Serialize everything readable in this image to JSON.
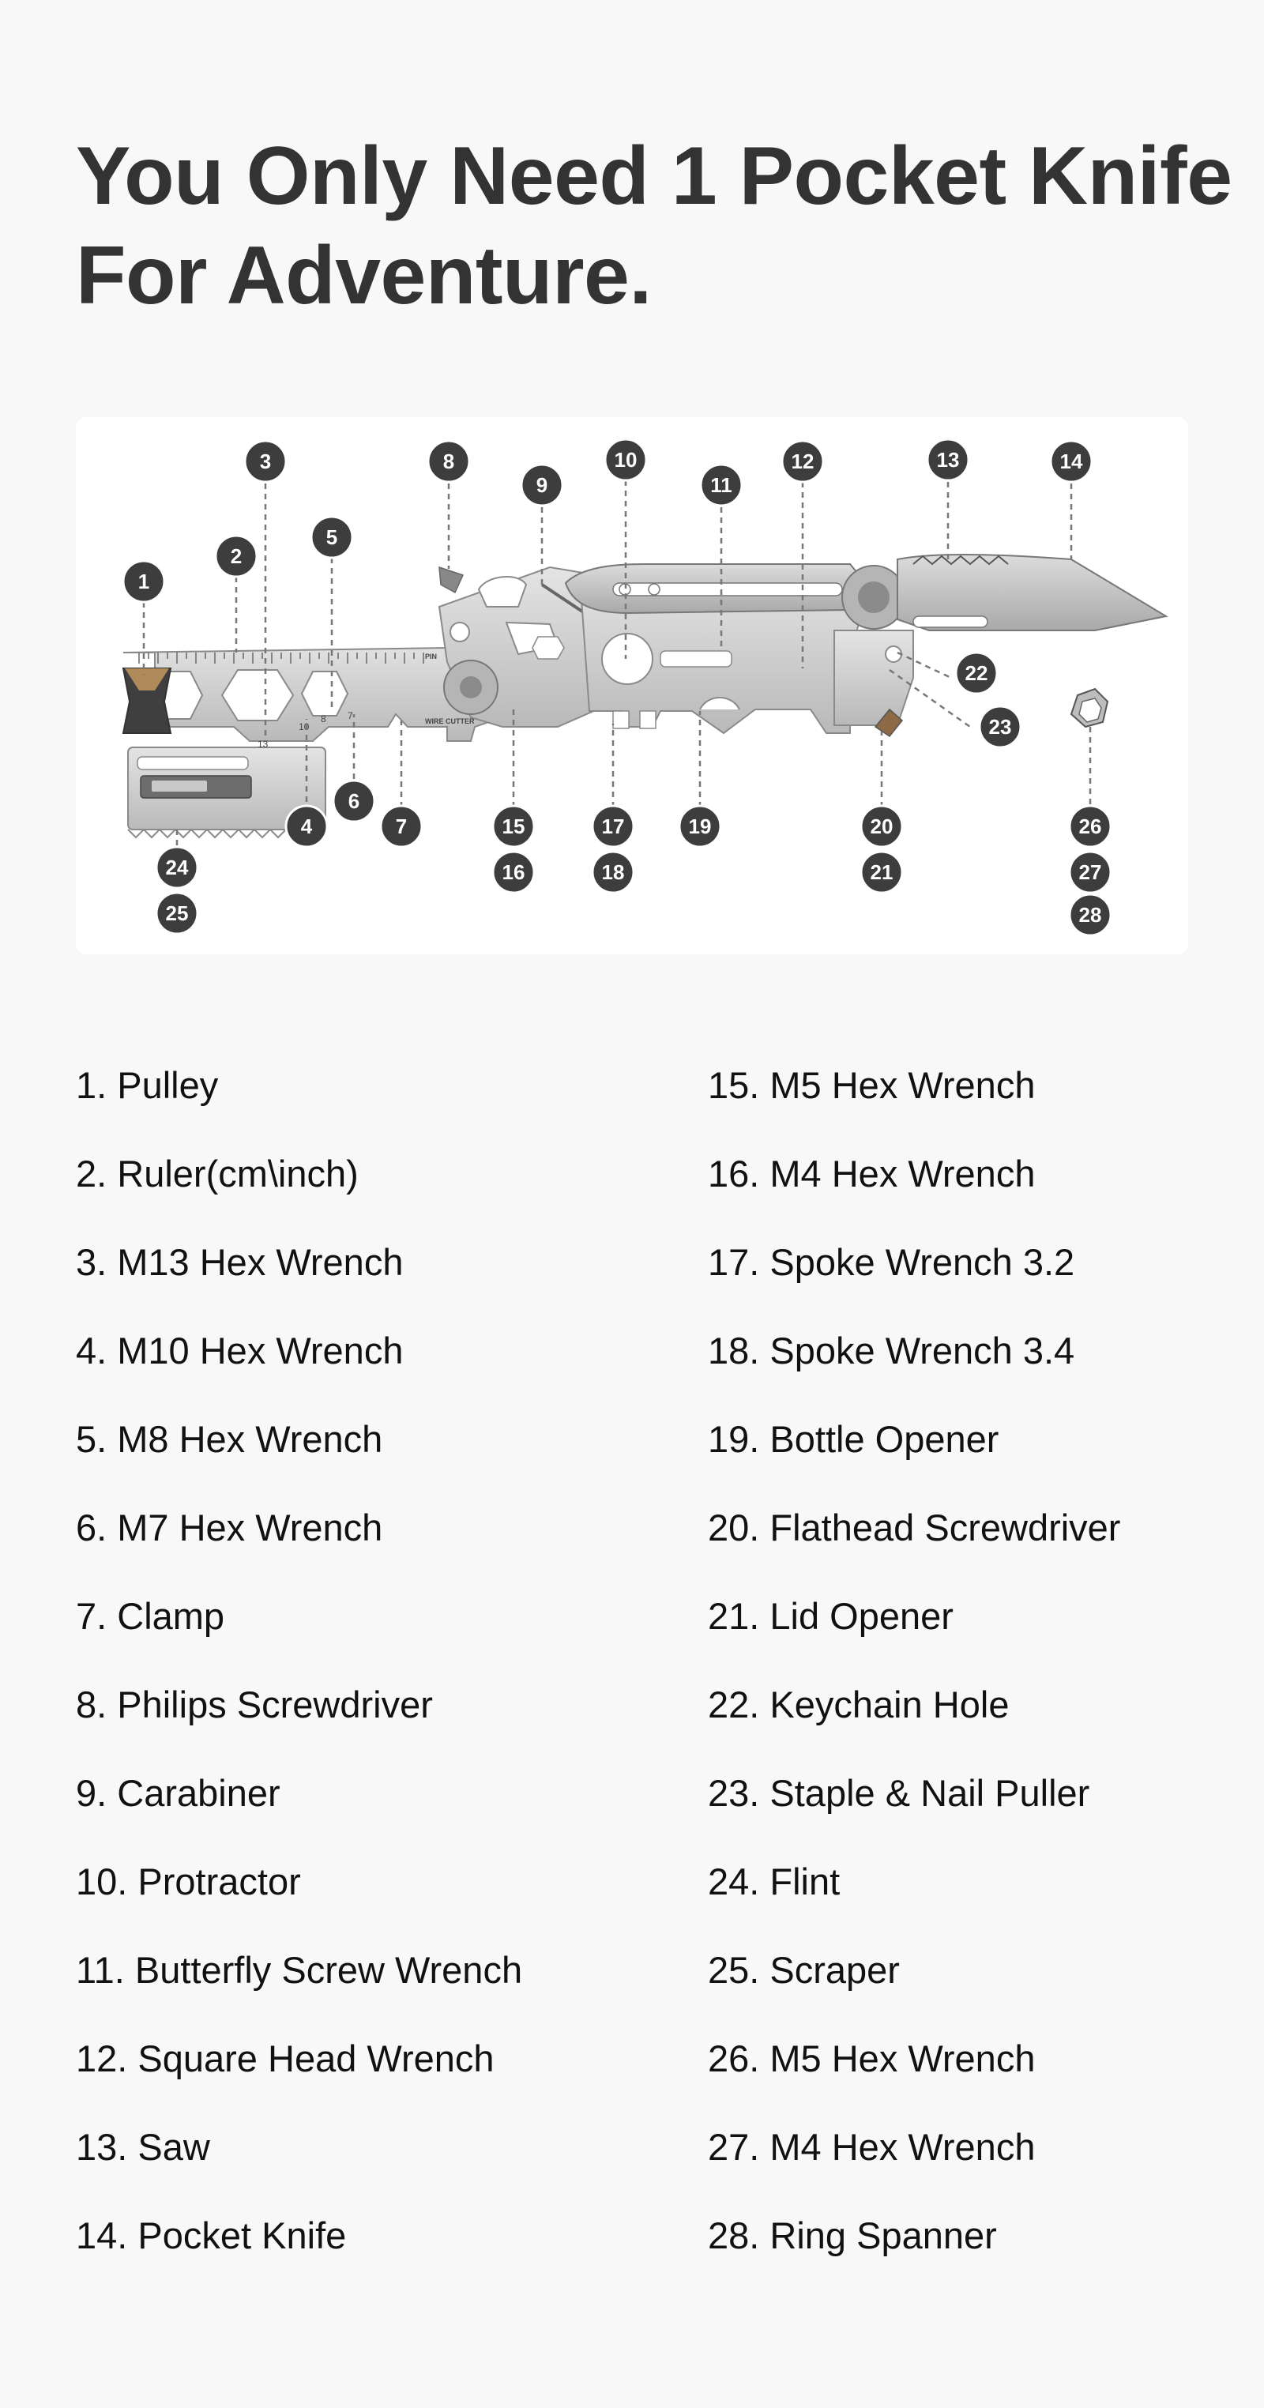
{
  "headline": {
    "line1": "You Only Need 1 Pocket Knife",
    "line2": "For Adventure."
  },
  "figure": {
    "engravings": {
      "wire_cutter": "WIRE CUTTER",
      "pin": "PIN",
      "scale_13": "13",
      "scale_10": "10",
      "scale_8": "8",
      "scale_7": "7"
    },
    "callouts": [
      "1",
      "2",
      "3",
      "4",
      "5",
      "6",
      "7",
      "8",
      "9",
      "10",
      "11",
      "12",
      "13",
      "14",
      "15",
      "16",
      "17",
      "18",
      "19",
      "20",
      "21",
      "22",
      "23",
      "24",
      "25",
      "26",
      "27",
      "28"
    ]
  },
  "specs": {
    "left": [
      "1. Pulley",
      "2. Ruler(cm\\inch)",
      "3. M13 Hex Wrench",
      "4. M10 Hex Wrench",
      "5. M8 Hex Wrench",
      "6. M7 Hex Wrench",
      "7. Clamp",
      "8. Philips Screwdriver",
      "9. Carabiner",
      "10. Protractor",
      "11. Butterfly Screw Wrench",
      "12. Square Head Wrench",
      "13. Saw",
      "14. Pocket Knife"
    ],
    "right": [
      "15. M5 Hex Wrench",
      "16. M4 Hex Wrench",
      "17. Spoke Wrench 3.2",
      "18. Spoke Wrench 3.4",
      "19. Bottle Opener",
      "20. Flathead Screwdriver",
      "21. Lid Opener",
      "22. Keychain Hole",
      "23. Staple & Nail Puller",
      "24. Flint",
      "25. Scraper",
      "26. M5 Hex Wrench",
      "27. M4 Hex Wrench",
      "28. Ring Spanner"
    ]
  },
  "colors": {
    "page_background": "#f8f8f8",
    "headline": "#333333",
    "body_text": "#111111",
    "callout_badge": "#3d3d3d",
    "tool_metal": "#cfcfcf"
  }
}
